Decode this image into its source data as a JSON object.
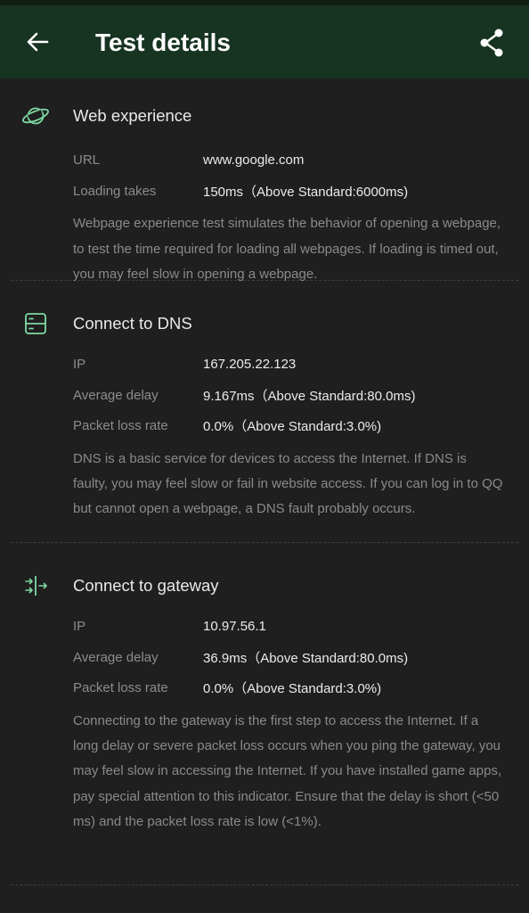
{
  "appbar": {
    "title": "Test details",
    "back_icon": "arrow-left-icon",
    "share_icon": "share-icon"
  },
  "colors": {
    "appbar_bg": "#173321",
    "page_bg": "#1f1f1f",
    "icon_accent": "#7fd9a3"
  },
  "sections": [
    {
      "icon": "planet-icon",
      "title": "Web experience",
      "rows": [
        {
          "label": "URL",
          "value": "www.google.com"
        },
        {
          "label": "Loading takes",
          "value": "150ms（Above Standard:6000ms)"
        }
      ],
      "description": "Webpage experience test simulates the behavior of opening a webpage, to test the time required for loading all webpages. If loading is timed out, you may feel slow in opening a webpage."
    },
    {
      "icon": "server-icon",
      "title": "Connect to DNS",
      "rows": [
        {
          "label": "IP",
          "value": "167.205.22.123"
        },
        {
          "label": "Average delay",
          "value": "9.167ms（Above Standard:80.0ms)"
        },
        {
          "label": "Packet loss rate",
          "value": "0.0%（Above Standard:3.0%)"
        }
      ],
      "description": "DNS is a basic service for devices to access the Internet. If DNS is faulty, you may feel slow or fail in website access. If you can log in to QQ but cannot open a webpage, a DNS fault probably occurs."
    },
    {
      "icon": "gateway-icon",
      "title": "Connect to gateway",
      "rows": [
        {
          "label": "IP",
          "value": "10.97.56.1"
        },
        {
          "label": "Average delay",
          "value": "36.9ms（Above Standard:80.0ms)"
        },
        {
          "label": "Packet loss rate",
          "value": "0.0%（Above Standard:3.0%)"
        }
      ],
      "description": "Connecting to the gateway is the first step to access the Internet. If a long delay or severe packet loss occurs when you ping the gateway, you may feel slow in accessing the Internet. If you have installed game apps, pay special attention to this indicator. Ensure that the delay is short (<50 ms) and the packet loss rate is low (<1%)."
    }
  ]
}
